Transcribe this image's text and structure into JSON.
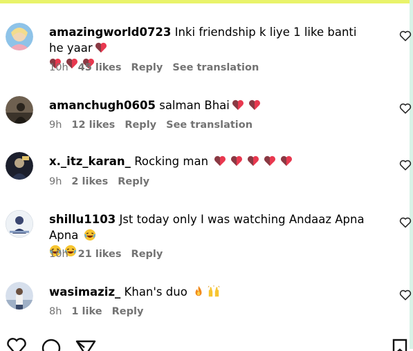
{
  "comments": [
    {
      "username": "amazingworld0723",
      "text": "Inki friendship k liye 1 like banti he yaar",
      "emojis_after": [
        "heart",
        "heart",
        "heart",
        "heart"
      ],
      "time": "10h",
      "likes": "45 likes",
      "reply": "Reply",
      "translation": "See translation",
      "avatar_colors": [
        "#f2d27a",
        "#7fb3d6"
      ]
    },
    {
      "username": "amanchugh0605",
      "text": "salman Bhai",
      "emojis_after": [
        "heart",
        "heart"
      ],
      "time": "9h",
      "likes": "12 likes",
      "reply": "Reply",
      "translation": "See translation",
      "avatar_colors": [
        "#3c3226",
        "#8d7b63"
      ]
    },
    {
      "username": "x._itz_karan_",
      "text": "Rocking man",
      "emojis_after": [
        "heart",
        "heart",
        "heart",
        "heart",
        "heart"
      ],
      "time": "9h",
      "likes": "2 likes",
      "reply": "Reply",
      "translation": "",
      "avatar_colors": [
        "#1f2230",
        "#c8b898"
      ]
    },
    {
      "username": "shillu1103",
      "text": "Jst today only I was watching Andaaz Apna Apna",
      "emojis_after": [
        "laugh",
        "laugh",
        "laugh"
      ],
      "time": "10h",
      "likes": "21 likes",
      "reply": "Reply",
      "translation": "",
      "avatar_colors": [
        "#e8edf3",
        "#2a3a66"
      ]
    },
    {
      "username": "wasimaziz_",
      "text": "Khan's duo",
      "emojis_after": [
        "fire",
        "praise"
      ],
      "time": "8h",
      "likes": "1 like",
      "reply": "Reply",
      "translation": "",
      "avatar_colors": [
        "#c9d4e6",
        "#5a6e8a"
      ]
    }
  ],
  "action_bar": {
    "icons": [
      "heart-outline-icon",
      "comment-icon",
      "share-icon",
      "bookmark-icon"
    ]
  },
  "colors": {
    "top_strip": "#e9f36a",
    "heart_red": "#e8384f",
    "meta_gray": "#737373"
  }
}
